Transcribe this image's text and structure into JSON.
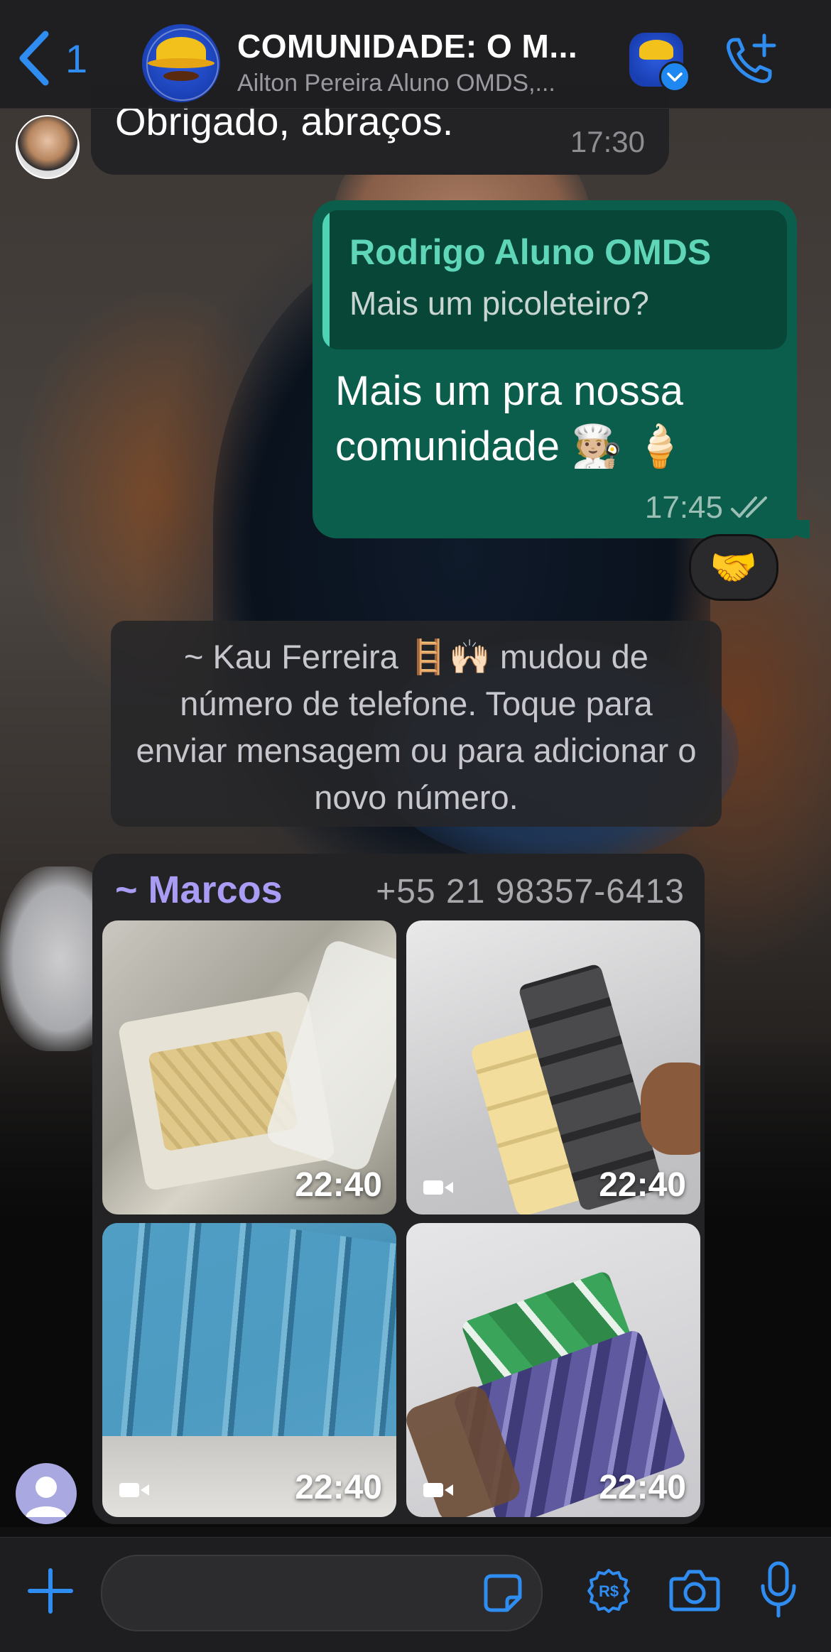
{
  "header": {
    "back_count": "1",
    "title": "COMUNIDADE: O M...",
    "subtitle": "Ailton Pereira Aluno OMDS,..."
  },
  "messages": {
    "incoming_partial": {
      "text": "Obrigado, abraços.",
      "time": "17:30"
    },
    "outgoing": {
      "quote_name": "Rodrigo Aluno OMDS",
      "quote_text": "Mais um picoleteiro?",
      "body_line1": "Mais um pra nossa",
      "body_line2": "comunidade 🧑🏼‍🍳 🍦",
      "time": "17:45",
      "reaction": "🤝"
    },
    "system": {
      "text": "~ Kau Ferreira 🪜🙌🏻 mudou de número de telefone. Toque para enviar mensagem ou para adicionar o novo número."
    },
    "media": {
      "sender": "~ Marcos",
      "phone": "+55 21 98357-6413",
      "tiles": [
        {
          "time": "22:40",
          "is_video": false
        },
        {
          "time": "22:40",
          "is_video": true
        },
        {
          "time": "22:40",
          "is_video": true
        },
        {
          "time": "22:40",
          "is_video": true
        }
      ]
    }
  },
  "input": {
    "placeholder": ""
  },
  "icons": [
    "chevron-left-icon",
    "add-call-icon",
    "verified-badge-icon",
    "plus-icon",
    "sticker-icon",
    "payment-icon",
    "camera-icon",
    "microphone-icon",
    "video-icon",
    "read-receipt-icon"
  ],
  "colors": {
    "accent": "#2f8cf0",
    "outgoing_bubble": "#0c5e4c",
    "incoming_bubble": "#232325",
    "sender_name": "#a89cf5",
    "quote_name": "#5fd6b8"
  }
}
